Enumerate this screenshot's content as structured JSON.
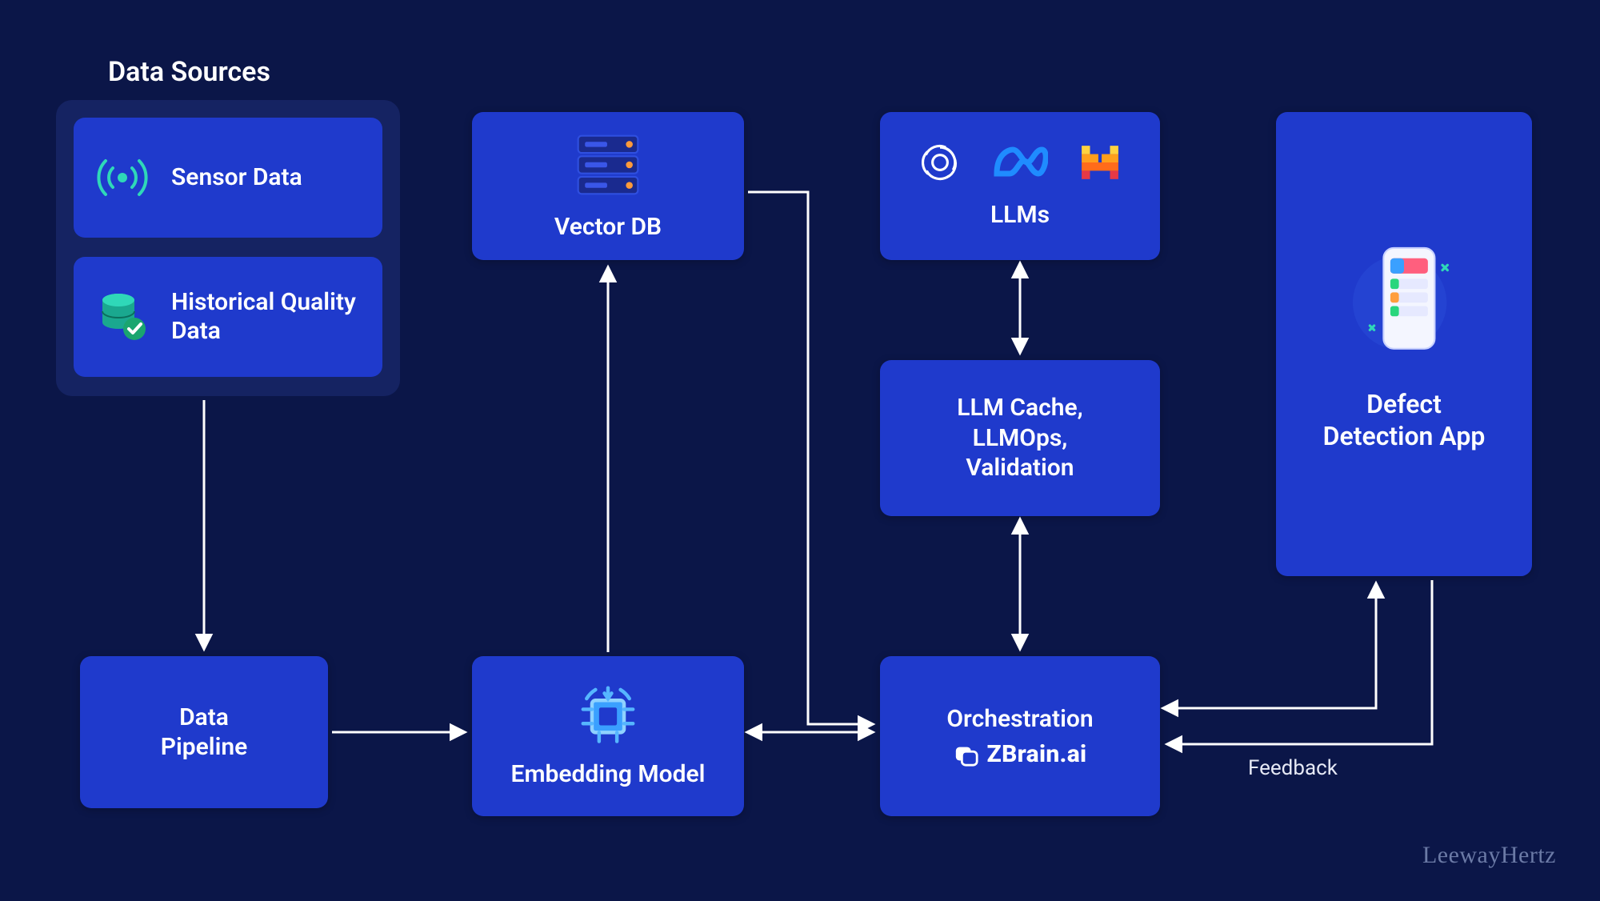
{
  "sources": {
    "title": "Data Sources",
    "items": [
      {
        "label": "Sensor Data",
        "icon": "broadcast-icon"
      },
      {
        "label": "Historical Quality Data",
        "icon": "database-check-icon"
      }
    ]
  },
  "nodes": {
    "data_pipeline": {
      "label": "Data\nPipeline"
    },
    "embedding": {
      "label": "Embedding Model"
    },
    "vector_db": {
      "label": "Vector DB"
    },
    "llms": {
      "label": "LLMs",
      "providers": [
        "openai",
        "meta",
        "mistral"
      ]
    },
    "llm_cache": {
      "label": "LLM Cache,\nLLMOps,\nValidation"
    },
    "orchestration": {
      "label": "Orchestration",
      "sublabel": "ZBrain.ai"
    },
    "app": {
      "label": "Defect\nDetection App"
    }
  },
  "edges": [
    {
      "from": "sources",
      "to": "data_pipeline",
      "dir": "uni"
    },
    {
      "from": "data_pipeline",
      "to": "embedding",
      "dir": "uni"
    },
    {
      "from": "embedding",
      "to": "vector_db",
      "dir": "uni"
    },
    {
      "from": "vector_db",
      "to": "orchestration",
      "dir": "uni"
    },
    {
      "from": "embedding",
      "to": "orchestration",
      "dir": "bi"
    },
    {
      "from": "llms",
      "to": "llm_cache",
      "dir": "bi"
    },
    {
      "from": "llm_cache",
      "to": "orchestration",
      "dir": "bi"
    },
    {
      "from": "orchestration",
      "to": "app",
      "dir": "bi"
    },
    {
      "from": "app",
      "to": "orchestration",
      "dir": "uni",
      "label": "Feedback"
    }
  ],
  "feedback_label": "Feedback",
  "brand": "LeewayHertz",
  "colors": {
    "bg": "#0b1648",
    "panel": "#1f3acc",
    "accent_teal": "#2fd8b8",
    "accent_blue": "#3aa0ff"
  }
}
